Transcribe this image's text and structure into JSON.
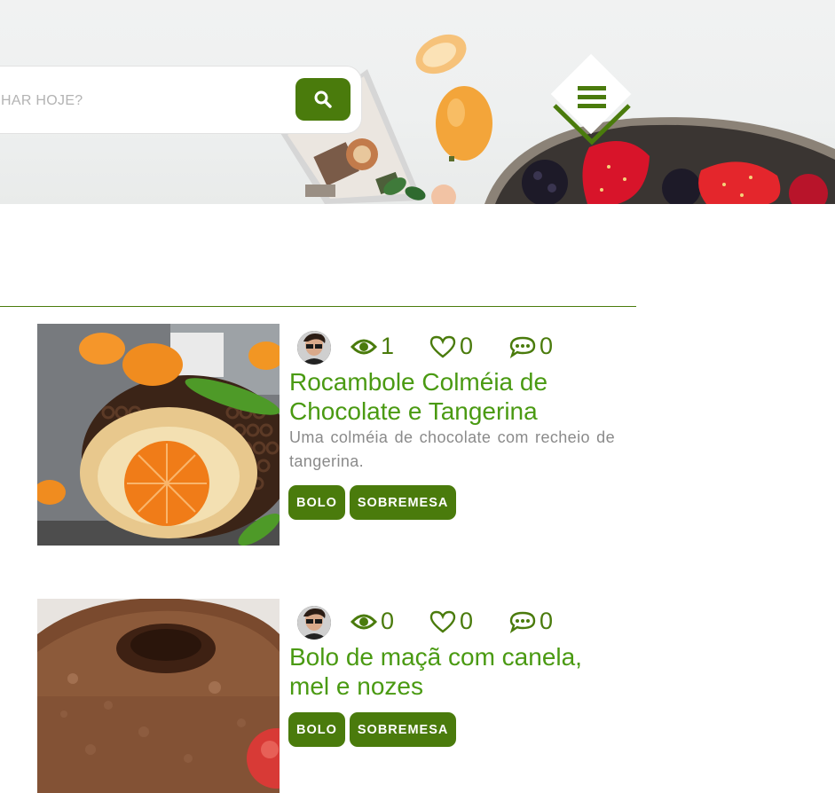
{
  "header": {
    "search": {
      "placeholder": "HAR HOJE?",
      "value": ""
    },
    "search_button_icon": "search-icon",
    "menu_icon": "hamburger-icon",
    "scroll_icon": "chevron-down-icon"
  },
  "colors": {
    "accent": "#4a7b0c",
    "title": "#4a9a12",
    "text_muted": "#8a8a8a"
  },
  "recipes": [
    {
      "views": "1",
      "likes": "0",
      "comments": "0",
      "title_line1": "Rocambole Colméia de",
      "title_line2": "Chocolate e Tangerina",
      "description": "Uma colméia de chocolate com recheio de tangerina.",
      "tags": [
        "BOLO",
        "SOBREMESA"
      ]
    },
    {
      "views": "0",
      "likes": "0",
      "comments": "0",
      "title_line1": "Bolo de maçã com canela,",
      "title_line2": "mel e nozes",
      "description": "",
      "tags": [
        "BOLO",
        "SOBREMESA"
      ]
    }
  ]
}
